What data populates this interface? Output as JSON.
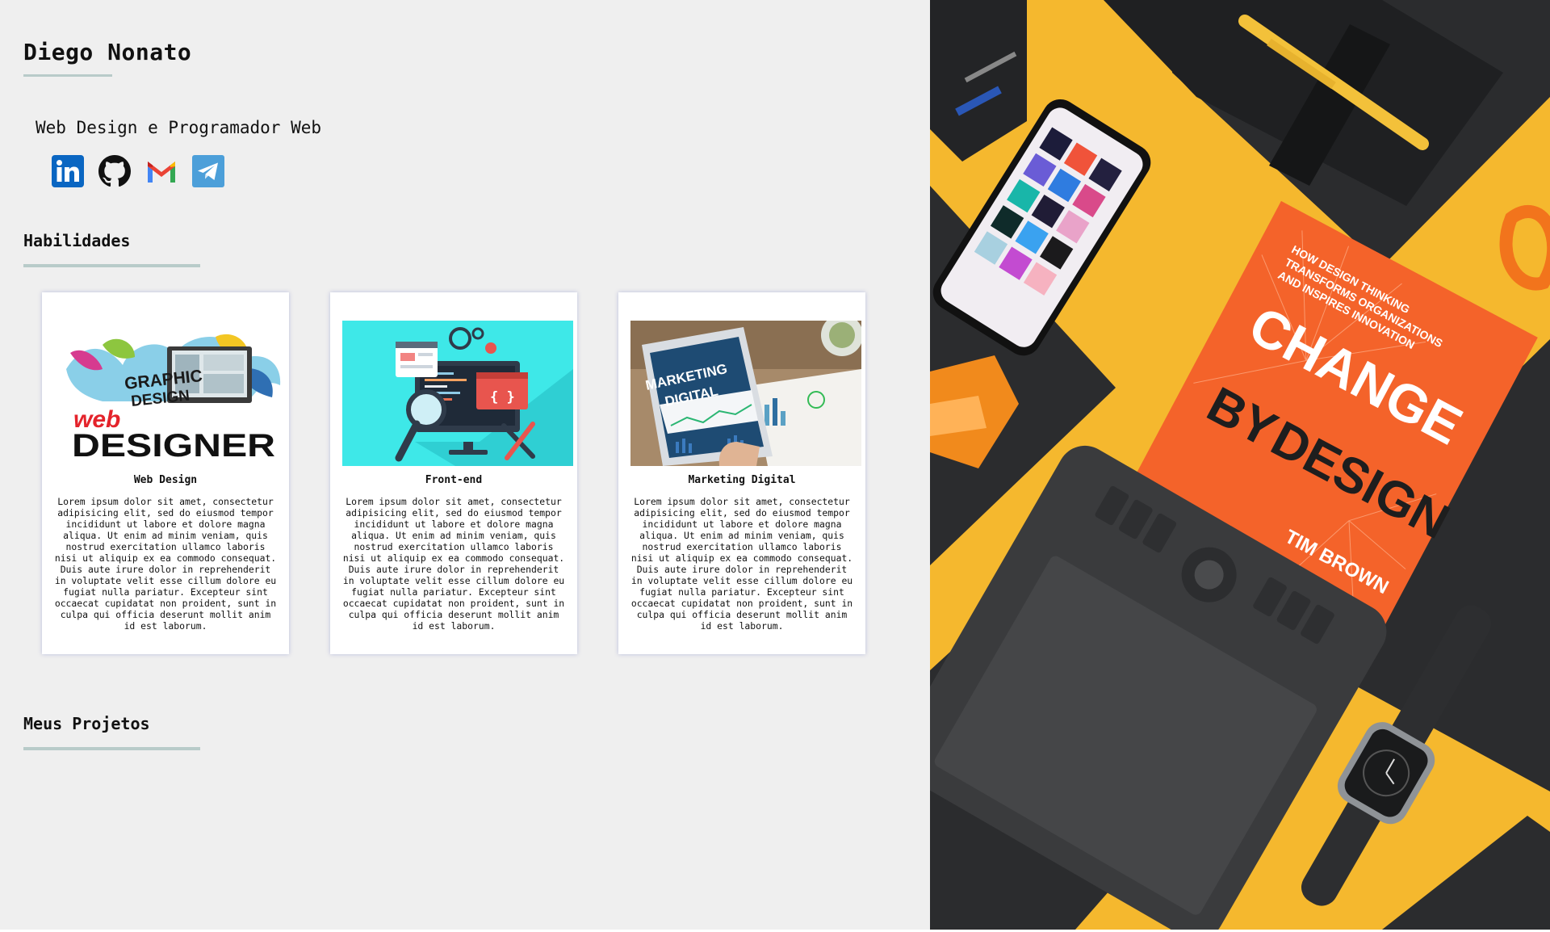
{
  "profile": {
    "name": "Diego Nonato",
    "subtitle": "Web Design e Programador Web"
  },
  "social": [
    {
      "icon": "linkedin-icon",
      "color": "#0a66c2"
    },
    {
      "icon": "github-icon",
      "color": "#111111"
    },
    {
      "icon": "gmail-icon",
      "color": "#ea4335"
    },
    {
      "icon": "telegram-icon",
      "color": "#4c9fd9"
    }
  ],
  "skills": {
    "title": "Habilidades",
    "cards": [
      {
        "title": "Web Design",
        "image_text": [
          "GRAPHIC",
          "DESIGN",
          "web",
          "DESIGNER"
        ],
        "text": "Lorem ipsum dolor sit amet, consectetur adipisicing elit, sed do eiusmod tempor incididunt ut labore et dolore magna aliqua. Ut enim ad minim veniam, quis nostrud exercitation ullamco laboris nisi ut aliquip ex ea commodo consequat. Duis aute irure dolor in reprehenderit in voluptate velit esse cillum dolore eu fugiat nulla pariatur. Excepteur sint occaecat cupidatat non proident, sunt in culpa qui officia deserunt mollit anim id est laborum."
      },
      {
        "title": "Front-end",
        "image_text": [
          "{ }"
        ],
        "text": "Lorem ipsum dolor sit amet, consectetur adipisicing elit, sed do eiusmod tempor incididunt ut labore et dolore magna aliqua. Ut enim ad minim veniam, quis nostrud exercitation ullamco laboris nisi ut aliquip ex ea commodo consequat. Duis aute irure dolor in reprehenderit in voluptate velit esse cillum dolore eu fugiat nulla pariatur. Excepteur sint occaecat cupidatat non proident, sunt in culpa qui officia deserunt mollit anim id est laborum."
      },
      {
        "title": "Marketing Digital",
        "image_text": [
          "MARKETING",
          "DIGITAL"
        ],
        "text": "Lorem ipsum dolor sit amet, consectetur adipisicing elit, sed do eiusmod tempor incididunt ut labore et dolore magna aliqua. Ut enim ad minim veniam, quis nostrud exercitation ullamco laboris nisi ut aliquip ex ea commodo consequat. Duis aute irure dolor in reprehenderit in voluptate velit esse cillum dolore eu fugiat nulla pariatur. Excepteur sint occaecat cupidatat non proident, sunt in culpa qui officia deserunt mollit anim id est laborum."
      }
    ]
  },
  "projects": {
    "title": "Meus Projetos"
  },
  "hero": {
    "book_lines": [
      "CHANGE",
      "BY",
      "DESIGN",
      "TIM BROWN",
      "HOW DESIGN THINKING",
      "TRANSFORMS ORGANIZATIONS",
      "AND INSPIRES INNOVATION"
    ]
  },
  "colors": {
    "page_bg": "#efefef",
    "rule": "#b8cbc9",
    "hero_yellow": "#f5b82e",
    "hero_dark": "#2b2c2e",
    "book_orange": "#f4632a"
  }
}
